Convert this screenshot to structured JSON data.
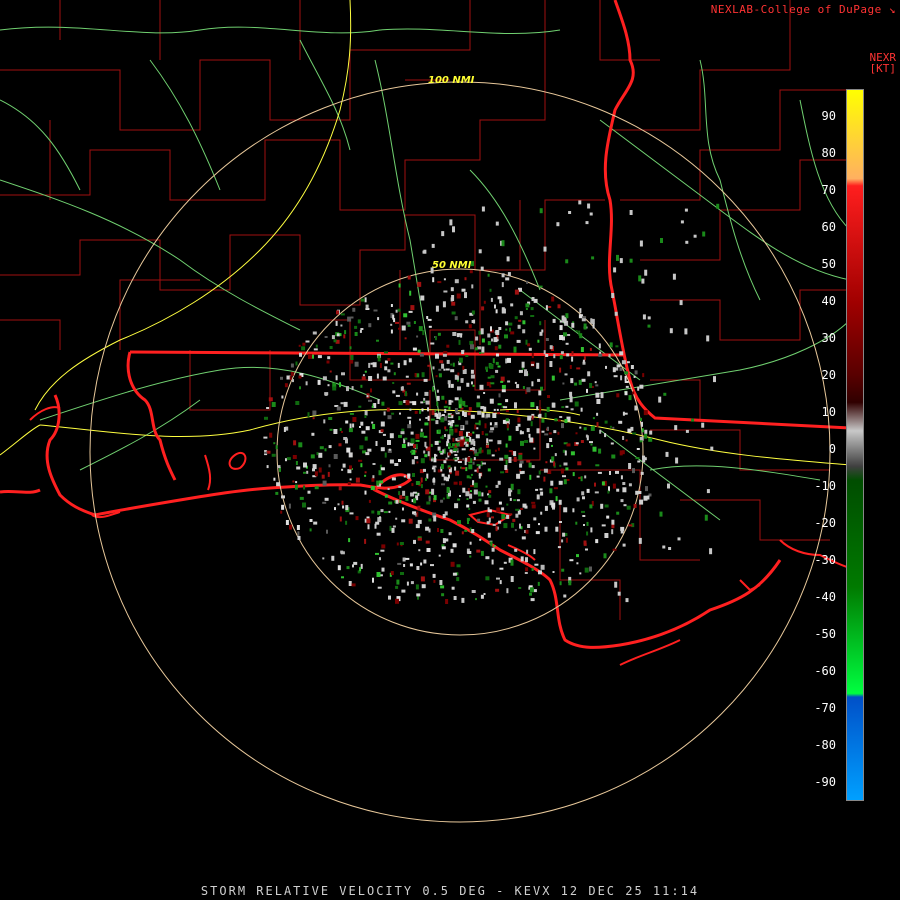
{
  "header": {
    "credit": "NEXLAB-College of DuPage",
    "credit_icon": "cod-logo-icon",
    "product_line1": "NEXR",
    "product_line2": "[KT]"
  },
  "footer": {
    "caption": "STORM RELATIVE VELOCITY 0.5 DEG - KEVX 12 DEC 25 11:14"
  },
  "range_rings": [
    {
      "label": "50 NMI",
      "nmi": 50
    },
    {
      "label": "100 NMI",
      "nmi": 100
    }
  ],
  "legend": {
    "unit": "[KT]",
    "ticks": [
      "90",
      "80",
      "70",
      "60",
      "50",
      "40",
      "30",
      "20",
      "10",
      "0",
      "-10",
      "-20",
      "-30",
      "-40",
      "-50",
      "-60",
      "-70",
      "-80",
      "-90"
    ],
    "colors": {
      "high_inbound": "#ffff00",
      "outbound_red": "#ff1e1e",
      "dark_red": "#5a0000",
      "near_zero": "#c8c8c8",
      "dark_green": "#004d00",
      "bright_green": "#00ff40",
      "blue": "#0050c8",
      "light_blue": "#00a0ff"
    }
  },
  "map_colors": {
    "state_border": "#ff2020",
    "county_border": "#b01010",
    "highway": "#ffff40",
    "road": "#80e080",
    "range_ring": "#e8c89a"
  }
}
